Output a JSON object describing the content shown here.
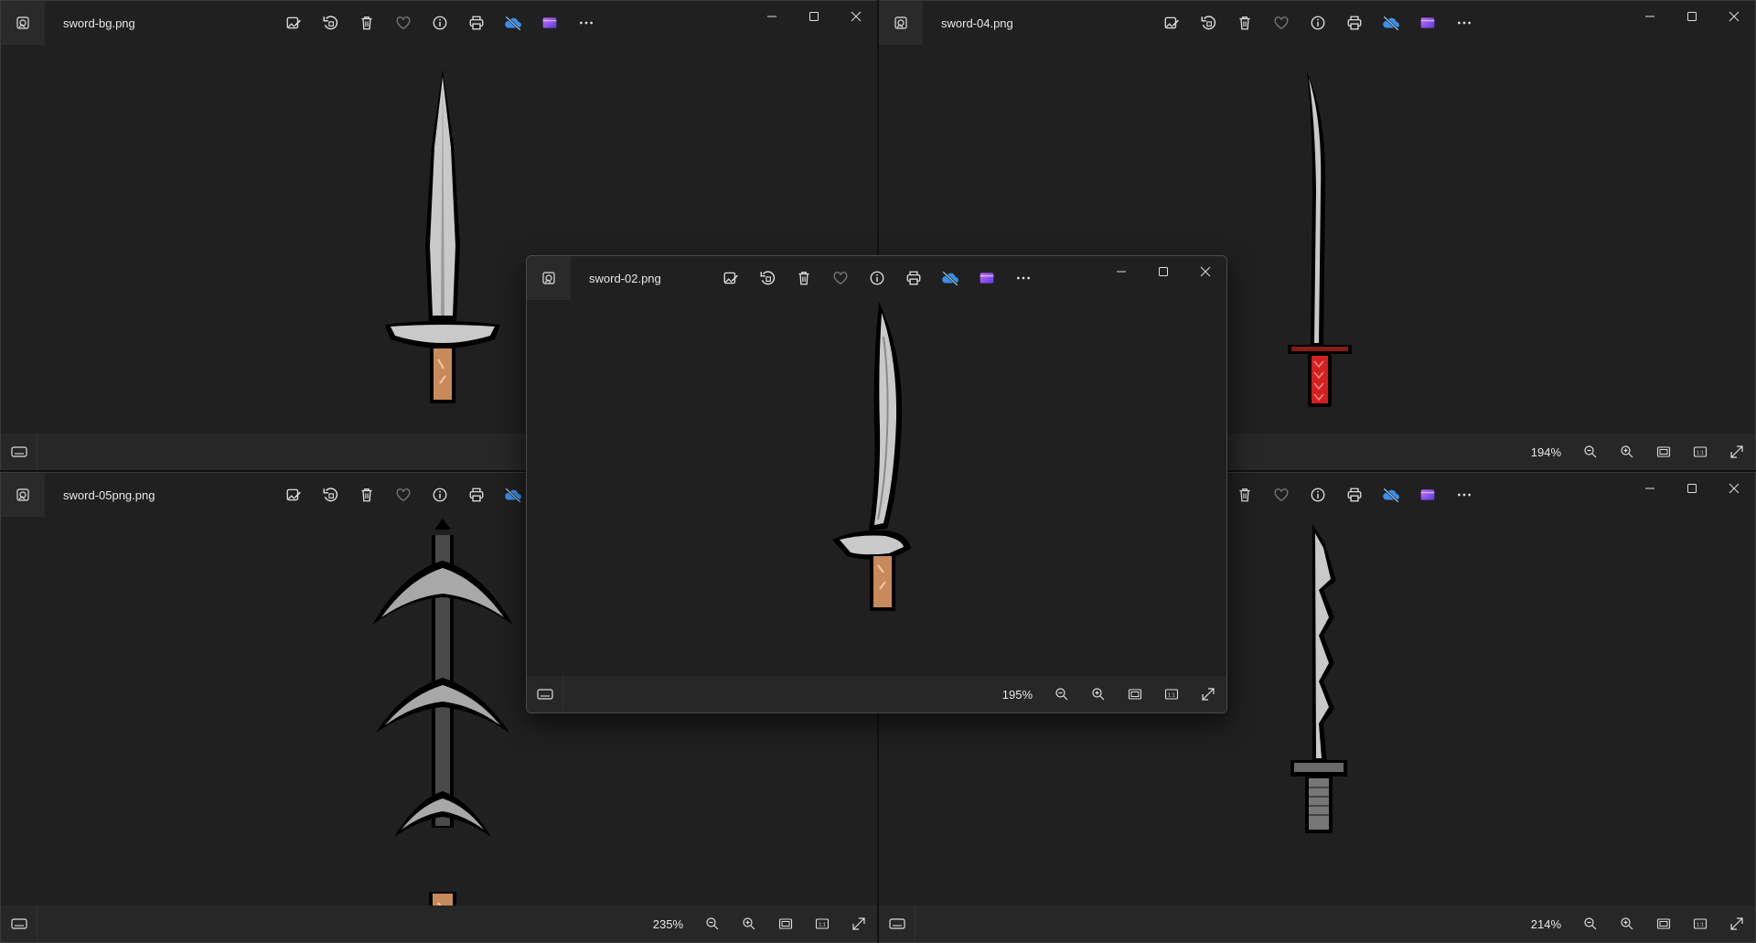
{
  "windows": {
    "top_left": {
      "title": "sword-bg.png"
    },
    "top_right": {
      "title": "sword-04.png",
      "zoom": "194%"
    },
    "bottom_left": {
      "title": "sword-05png.png",
      "zoom": "235%"
    },
    "bottom_right": {
      "zoom": "214%"
    },
    "center": {
      "title": "sword-02.png",
      "zoom": "195%"
    }
  },
  "toolbar_icons": [
    "edit-image-icon",
    "rotate-icon",
    "delete-icon",
    "favorite-heart-icon",
    "info-icon",
    "print-icon",
    "onedrive-cloud-icon",
    "clipchamp-icon",
    "more-options-icon"
  ],
  "caption_buttons": [
    "minimize-button",
    "maximize-button",
    "close-button"
  ],
  "colors": {
    "background": "#202020",
    "status_bar": "#272727",
    "text": "#e8e8e8",
    "onedrive_blue": "#3a8fe8",
    "clipchamp_purple": "#8a5cf0"
  }
}
